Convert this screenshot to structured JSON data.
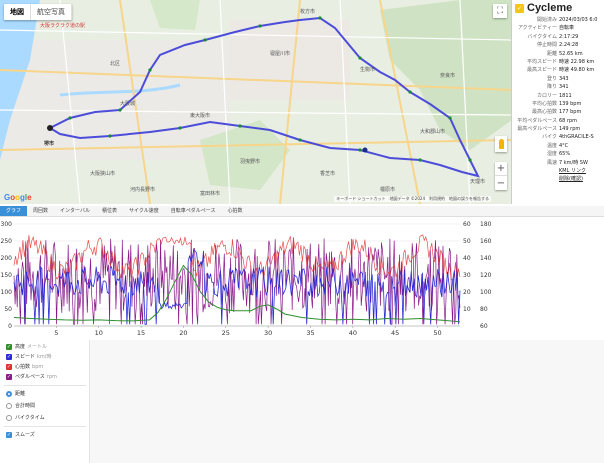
{
  "map": {
    "tabs": [
      "地図",
      "航空写真"
    ],
    "footer": "キーボード ショートカット　地図データ ©2024　利用規約　地図の誤りを報告する",
    "labels": [
      "大阪ラクラク道の駅",
      "北区",
      "枚方市",
      "寝屋川市",
      "大阪城",
      "東大阪市",
      "堺市",
      "生駒市",
      "奈良市",
      "大和郡山市",
      "天理市",
      "香芝市",
      "橿原市",
      "羽曳野市",
      "富田林市",
      "河内長野市",
      "大阪狭山市"
    ]
  },
  "info": {
    "app_name": "Cycleme",
    "rows": [
      {
        "k": "開始済み",
        "v": "2024/03/03 6:0"
      },
      {
        "k": "アクティビティー",
        "v": "自転車"
      },
      {
        "k": "バイクタイム",
        "v": "2:17:29"
      },
      {
        "k": "停止時間",
        "v": "2:24:28"
      },
      {
        "k": "距離",
        "v": "52.65 km"
      },
      {
        "k": "平均スピード",
        "v": "時速 22.98 km"
      },
      {
        "k": "最高スピード",
        "v": "時速 49.80 km"
      },
      {
        "k": "登り",
        "v": "343"
      },
      {
        "k": "降り",
        "v": "341"
      },
      {
        "k": "カロリー",
        "v": "1811"
      },
      {
        "k": "平均心拍数",
        "v": "139 bpm"
      },
      {
        "k": "最高心拍数",
        "v": "177 bpm"
      },
      {
        "k": "平均ペダルペース",
        "v": "68 rpm"
      },
      {
        "k": "最高ペダルペース",
        "v": "149 rpm"
      },
      {
        "k": "バイク",
        "v": "4thGRACILE-S"
      },
      {
        "k": "温度",
        "v": "4°C"
      },
      {
        "k": "湿度",
        "v": "65%"
      },
      {
        "k": "風速",
        "v": "7 km/時 SW"
      }
    ],
    "kml_link": "KML リンク",
    "delete_link": "削除(確認)"
  },
  "tabs": [
    "グラフ",
    "周回数",
    "インターバル",
    "積位表",
    "サイクル速度",
    "自転車ペダルペース",
    "心拍数"
  ],
  "chart_data": {
    "type": "line",
    "x_ticks": [
      "5",
      "10",
      "15",
      "20",
      "25",
      "30",
      "35",
      "40",
      "45",
      "50"
    ],
    "x_range": [
      0,
      52.65
    ],
    "y_left_ticks": [
      "0",
      "50",
      "100",
      "150",
      "200",
      "250",
      "300"
    ],
    "y_left_range": [
      0,
      300
    ],
    "y_right1_ticks": [
      "10",
      "20",
      "30",
      "40",
      "50",
      "60"
    ],
    "y_right1_range": [
      0,
      60
    ],
    "y_right2_ticks": [
      "60",
      "80",
      "100",
      "120",
      "140",
      "160",
      "180"
    ],
    "y_right2_range": [
      60,
      180
    ],
    "colors": {
      "elevation": "#2f8f2f",
      "speed": "#2b2bd6",
      "heart": "#e03030",
      "cadence": "#8a1a8a"
    },
    "elevation": [
      [
        0,
        25
      ],
      [
        2,
        22
      ],
      [
        4,
        20
      ],
      [
        6,
        18
      ],
      [
        8,
        17
      ],
      [
        10,
        18
      ],
      [
        12,
        16
      ],
      [
        14,
        15
      ],
      [
        16,
        18
      ],
      [
        17,
        40
      ],
      [
        18,
        80
      ],
      [
        19,
        130
      ],
      [
        20,
        178
      ],
      [
        21,
        150
      ],
      [
        22,
        100
      ],
      [
        23,
        70
      ],
      [
        24,
        55
      ],
      [
        25,
        48
      ],
      [
        26,
        45
      ],
      [
        28,
        45
      ],
      [
        29,
        58
      ],
      [
        30,
        62
      ],
      [
        31,
        50
      ],
      [
        32,
        35
      ],
      [
        34,
        25
      ],
      [
        36,
        20
      ],
      [
        38,
        18
      ],
      [
        40,
        20
      ],
      [
        42,
        18
      ],
      [
        44,
        22
      ],
      [
        46,
        20
      ],
      [
        48,
        22
      ],
      [
        50,
        18
      ],
      [
        52,
        14
      ],
      [
        52.65,
        12
      ]
    ]
  },
  "legend": {
    "series": [
      {
        "label": "高度",
        "unit": "メートル",
        "color": "#2f8f2f"
      },
      {
        "label": "スピード",
        "unit": "km/時",
        "color": "#2b2bd6"
      },
      {
        "label": "心拍数",
        "unit": "bpm",
        "color": "#e03030"
      },
      {
        "label": "ペダルペース",
        "unit": "rpm",
        "color": "#8a1a8a"
      }
    ],
    "x_options": [
      "距離",
      "合計時間",
      "バイクタイム"
    ],
    "smooth_label": "スムーズ"
  }
}
